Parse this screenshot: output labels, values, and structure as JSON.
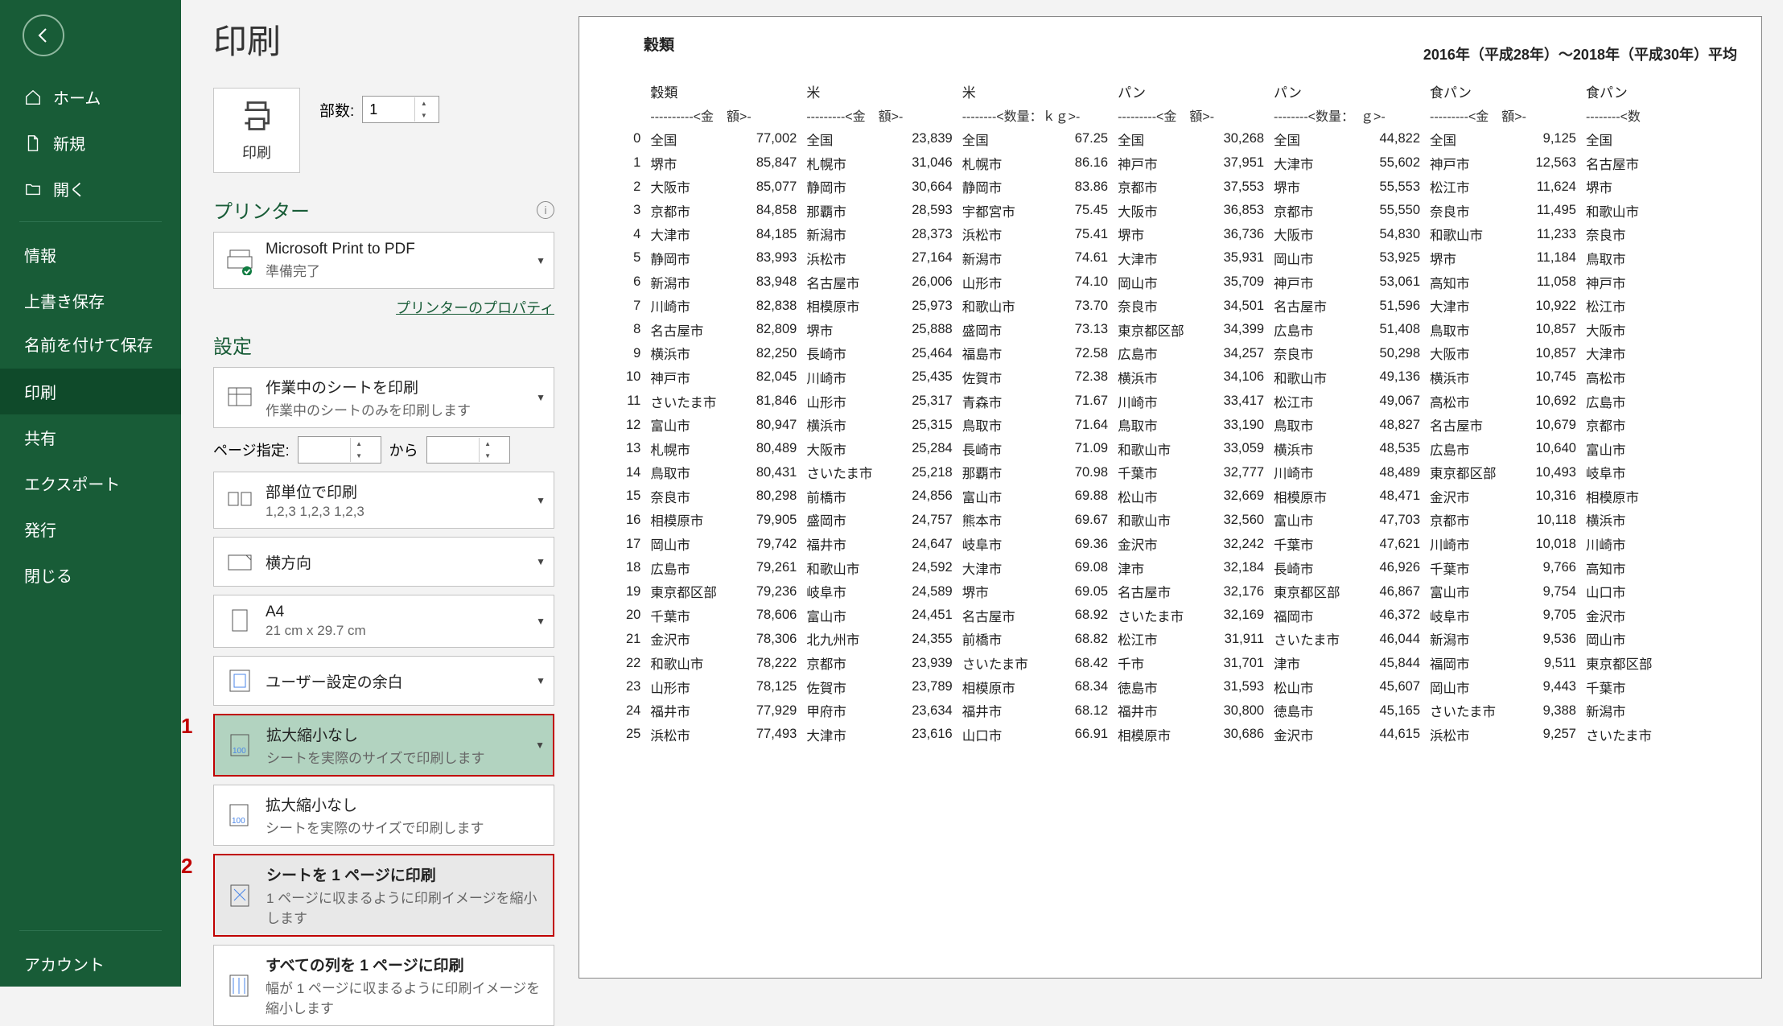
{
  "page_title": "印刷",
  "sidebar": {
    "home": "ホーム",
    "new": "新規",
    "open": "開く",
    "info": "情報",
    "save": "上書き保存",
    "saveas": "名前を付けて保存",
    "print": "印刷",
    "share": "共有",
    "export": "エクスポート",
    "publish": "発行",
    "close": "閉じる",
    "account": "アカウント"
  },
  "print_button": "印刷",
  "copies_label": "部数:",
  "copies_value": "1",
  "printer_heading": "プリンター",
  "printer_name": "Microsoft Print to PDF",
  "printer_status": "準備完了",
  "printer_props_link": "プリンターのプロパティ",
  "settings_heading": "設定",
  "print_what": {
    "title": "作業中のシートを印刷",
    "sub": "作業中のシートのみを印刷します"
  },
  "page_spec_label": "ページ指定:",
  "page_spec_from_label": "から",
  "collate": {
    "title": "部単位で印刷",
    "sub": "1,2,3   1,2,3   1,2,3"
  },
  "orientation": "横方向",
  "paper": {
    "title": "A4",
    "sub": "21 cm x 29.7 cm"
  },
  "margins": "ユーザー設定の余白",
  "scaling_current": {
    "title": "拡大縮小なし",
    "sub": "シートを実際のサイズで印刷します"
  },
  "scaling_opt1": {
    "title": "拡大縮小なし",
    "sub": "シートを実際のサイズで印刷します"
  },
  "scaling_opt2": {
    "title": "シートを 1 ページに印刷",
    "sub": "1 ページに収まるように印刷イメージを縮小します"
  },
  "scaling_opt3": {
    "title": "すべての列を 1 ページに印刷",
    "sub": "幅が 1 ページに収まるように印刷イメージを縮小します"
  },
  "marker1": "1",
  "marker2": "2",
  "doc": {
    "title": "穀類",
    "date_range": "2016年（平成28年）～2018年（平成30年）平均",
    "headers1": [
      "穀類",
      "",
      "米",
      "",
      "米",
      "",
      "パン",
      "",
      "パン",
      "",
      "食パン",
      "",
      "食パン",
      ""
    ],
    "headers2": [
      "----------<金　額>-",
      "",
      "---------<金　額>-",
      "",
      "--------<数量：ｋｇ>-",
      "",
      "---------<金　額>-",
      "",
      "--------<数量：　ｇ>-",
      "",
      "---------<金　額>-",
      "",
      "--------<数"
    ],
    "rows": [
      [
        "0",
        "全国",
        "77,002",
        "全国",
        "23,839",
        "全国",
        "67.25",
        "全国",
        "30,268",
        "全国",
        "44,822",
        "全国",
        "9,125",
        "全国"
      ],
      [
        "1",
        "堺市",
        "85,847",
        "札幌市",
        "31,046",
        "札幌市",
        "86.16",
        "神戸市",
        "37,951",
        "大津市",
        "55,602",
        "神戸市",
        "12,563",
        "名古屋市"
      ],
      [
        "2",
        "大阪市",
        "85,077",
        "静岡市",
        "30,664",
        "静岡市",
        "83.86",
        "京都市",
        "37,553",
        "堺市",
        "55,553",
        "松江市",
        "11,624",
        "堺市"
      ],
      [
        "3",
        "京都市",
        "84,858",
        "那覇市",
        "28,593",
        "宇都宮市",
        "75.45",
        "大阪市",
        "36,853",
        "京都市",
        "55,550",
        "奈良市",
        "11,495",
        "和歌山市"
      ],
      [
        "4",
        "大津市",
        "84,185",
        "新潟市",
        "28,373",
        "浜松市",
        "75.41",
        "堺市",
        "36,736",
        "大阪市",
        "54,830",
        "和歌山市",
        "11,233",
        "奈良市"
      ],
      [
        "5",
        "静岡市",
        "83,993",
        "浜松市",
        "27,164",
        "新潟市",
        "74.61",
        "大津市",
        "35,931",
        "岡山市",
        "53,925",
        "堺市",
        "11,184",
        "鳥取市"
      ],
      [
        "6",
        "新潟市",
        "83,948",
        "名古屋市",
        "26,006",
        "山形市",
        "74.10",
        "岡山市",
        "35,709",
        "神戸市",
        "53,061",
        "高知市",
        "11,058",
        "神戸市"
      ],
      [
        "7",
        "川崎市",
        "82,838",
        "相模原市",
        "25,973",
        "和歌山市",
        "73.70",
        "奈良市",
        "34,501",
        "名古屋市",
        "51,596",
        "大津市",
        "10,922",
        "松江市"
      ],
      [
        "8",
        "名古屋市",
        "82,809",
        "堺市",
        "25,888",
        "盛岡市",
        "73.13",
        "東京都区部",
        "34,399",
        "広島市",
        "51,408",
        "鳥取市",
        "10,857",
        "大阪市"
      ],
      [
        "9",
        "横浜市",
        "82,250",
        "長崎市",
        "25,464",
        "福島市",
        "72.58",
        "広島市",
        "34,257",
        "奈良市",
        "50,298",
        "大阪市",
        "10,857",
        "大津市"
      ],
      [
        "10",
        "神戸市",
        "82,045",
        "川崎市",
        "25,435",
        "佐賀市",
        "72.38",
        "横浜市",
        "34,106",
        "和歌山市",
        "49,136",
        "横浜市",
        "10,745",
        "高松市"
      ],
      [
        "11",
        "さいたま市",
        "81,846",
        "山形市",
        "25,317",
        "青森市",
        "71.67",
        "川崎市",
        "33,417",
        "松江市",
        "49,067",
        "高松市",
        "10,692",
        "広島市"
      ],
      [
        "12",
        "富山市",
        "80,947",
        "横浜市",
        "25,315",
        "鳥取市",
        "71.64",
        "鳥取市",
        "33,190",
        "鳥取市",
        "48,827",
        "名古屋市",
        "10,679",
        "京都市"
      ],
      [
        "13",
        "札幌市",
        "80,489",
        "大阪市",
        "25,284",
        "長崎市",
        "71.09",
        "和歌山市",
        "33,059",
        "横浜市",
        "48,535",
        "広島市",
        "10,640",
        "富山市"
      ],
      [
        "14",
        "鳥取市",
        "80,431",
        "さいたま市",
        "25,218",
        "那覇市",
        "70.98",
        "千葉市",
        "32,777",
        "川崎市",
        "48,489",
        "東京都区部",
        "10,493",
        "岐阜市"
      ],
      [
        "15",
        "奈良市",
        "80,298",
        "前橋市",
        "24,856",
        "富山市",
        "69.88",
        "松山市",
        "32,669",
        "相模原市",
        "48,471",
        "金沢市",
        "10,316",
        "相模原市"
      ],
      [
        "16",
        "相模原市",
        "79,905",
        "盛岡市",
        "24,757",
        "熊本市",
        "69.67",
        "和歌山市",
        "32,560",
        "富山市",
        "47,703",
        "京都市",
        "10,118",
        "横浜市"
      ],
      [
        "17",
        "岡山市",
        "79,742",
        "福井市",
        "24,647",
        "岐阜市",
        "69.36",
        "金沢市",
        "32,242",
        "千葉市",
        "47,621",
        "川崎市",
        "10,018",
        "川崎市"
      ],
      [
        "18",
        "広島市",
        "79,261",
        "和歌山市",
        "24,592",
        "大津市",
        "69.08",
        "津市",
        "32,184",
        "長崎市",
        "46,926",
        "千葉市",
        "9,766",
        "高知市"
      ],
      [
        "19",
        "東京都区部",
        "79,236",
        "岐阜市",
        "24,589",
        "堺市",
        "69.05",
        "名古屋市",
        "32,176",
        "東京都区部",
        "46,867",
        "富山市",
        "9,754",
        "山口市"
      ],
      [
        "20",
        "千葉市",
        "78,606",
        "富山市",
        "24,451",
        "名古屋市",
        "68.92",
        "さいたま市",
        "32,169",
        "福岡市",
        "46,372",
        "岐阜市",
        "9,705",
        "金沢市"
      ],
      [
        "21",
        "金沢市",
        "78,306",
        "北九州市",
        "24,355",
        "前橋市",
        "68.82",
        "松江市",
        "31,911",
        "さいたま市",
        "46,044",
        "新潟市",
        "9,536",
        "岡山市"
      ],
      [
        "22",
        "和歌山市",
        "78,222",
        "京都市",
        "23,939",
        "さいたま市",
        "68.42",
        "千市",
        "31,701",
        "津市",
        "45,844",
        "福岡市",
        "9,511",
        "東京都区部"
      ],
      [
        "23",
        "山形市",
        "78,125",
        "佐賀市",
        "23,789",
        "相模原市",
        "68.34",
        "徳島市",
        "31,593",
        "松山市",
        "45,607",
        "岡山市",
        "9,443",
        "千葉市"
      ],
      [
        "24",
        "福井市",
        "77,929",
        "甲府市",
        "23,634",
        "福井市",
        "68.12",
        "福井市",
        "30,800",
        "徳島市",
        "45,165",
        "さいたま市",
        "9,388",
        "新潟市"
      ],
      [
        "25",
        "浜松市",
        "77,493",
        "大津市",
        "23,616",
        "山口市",
        "66.91",
        "相模原市",
        "30,686",
        "金沢市",
        "44,615",
        "浜松市",
        "9,257",
        "さいたま市"
      ]
    ]
  }
}
